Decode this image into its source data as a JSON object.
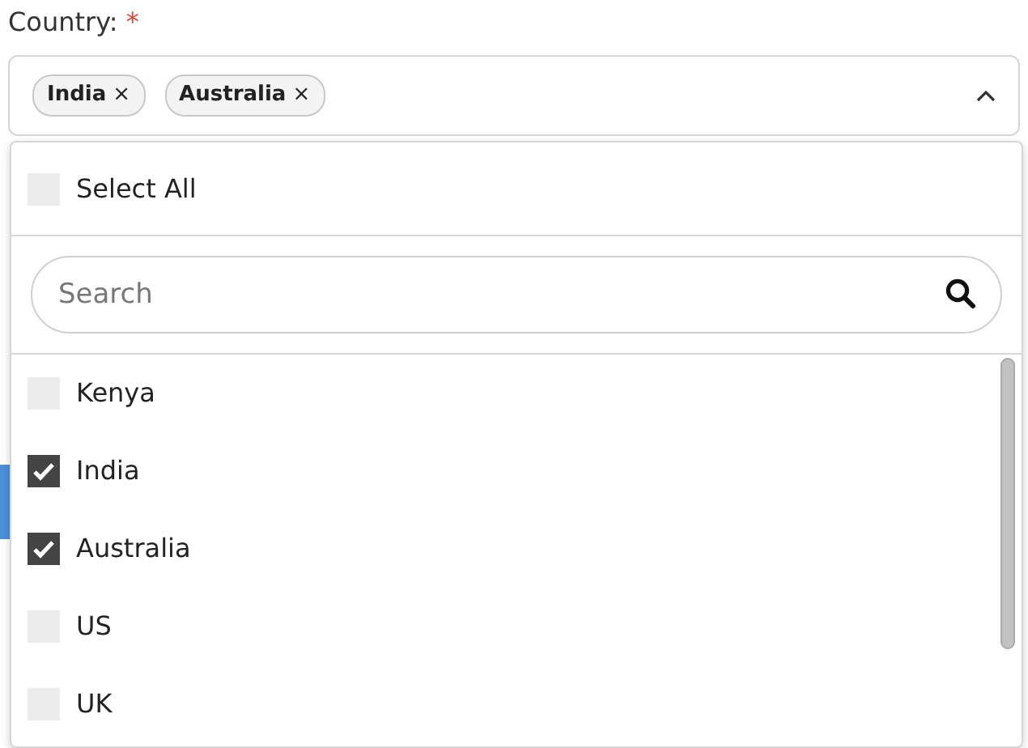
{
  "field": {
    "label": "Country:",
    "required_mark": "*"
  },
  "tags": [
    {
      "label": "India",
      "remove": "×"
    },
    {
      "label": "Australia",
      "remove": "×"
    }
  ],
  "dropdown": {
    "expanded": true,
    "select_all": {
      "label": "Select All",
      "checked": false
    },
    "search": {
      "placeholder": "Search"
    },
    "options": [
      {
        "label": "Kenya",
        "checked": false
      },
      {
        "label": "India",
        "checked": true
      },
      {
        "label": "Australia",
        "checked": true
      },
      {
        "label": "US",
        "checked": false
      },
      {
        "label": "UK",
        "checked": false
      }
    ]
  }
}
